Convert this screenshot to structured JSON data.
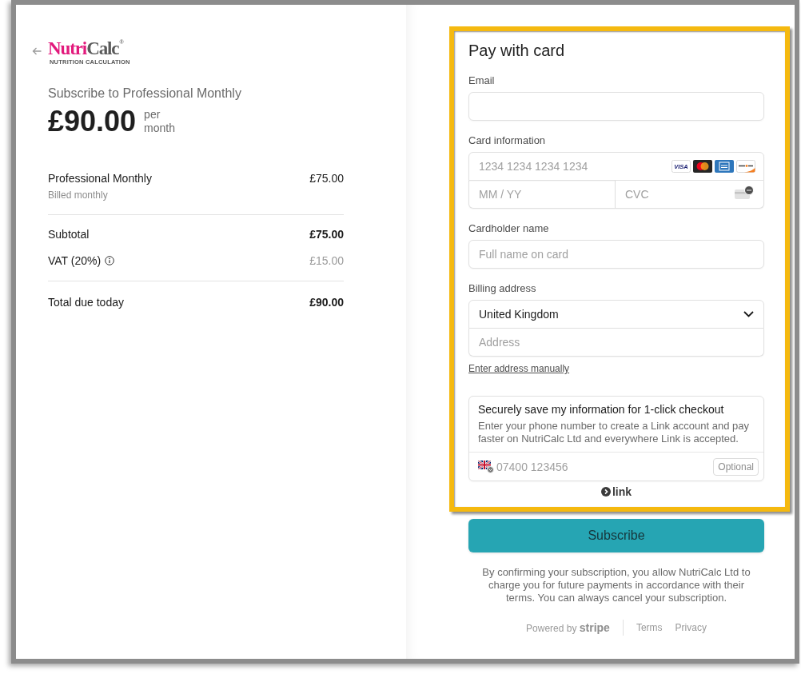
{
  "logo": {
    "name_parts": [
      "Nutri",
      "Calc"
    ],
    "registered_mark": "®",
    "tagline": "NUTRITION CALCULATION"
  },
  "summary": {
    "heading": "Subscribe to Professional Monthly",
    "price": "£90.00",
    "period": "per month"
  },
  "line_items": [
    {
      "name": "Professional Monthly",
      "note": "Billed monthly",
      "amount": "£75.00"
    }
  ],
  "totals": [
    {
      "kind": "subtotal",
      "label": "Subtotal",
      "amount": "£75.00"
    },
    {
      "kind": "tax",
      "label": "VAT (20%)",
      "amount": "£15.00"
    },
    {
      "kind": "total",
      "label": "Total due today",
      "amount": "£90.00"
    }
  ],
  "payment": {
    "highlighted": true,
    "title": "Pay with card",
    "email": {
      "label": "Email"
    },
    "card": {
      "label": "Card information",
      "number_placeholder": "1234 1234 1234 1234",
      "brands": [
        {
          "kind": "visa",
          "text": "VISA"
        },
        {
          "kind": "mastercard"
        },
        {
          "kind": "amex"
        },
        {
          "kind": "discover"
        }
      ],
      "expiry_placeholder": "MM / YY",
      "cvc_placeholder": "CVC"
    },
    "cardholder": {
      "label": "Cardholder name",
      "placeholder": "Full name on card"
    },
    "billing": {
      "label": "Billing address",
      "country": "United Kingdom",
      "address_placeholder": "Address",
      "manual_entry_link": "Enter address manually"
    },
    "link_signup": {
      "title": "Securely save my information for 1-click checkout",
      "description": "Enter your phone number to create a Link account and pay faster on NutriCalc Ltd and everywhere Link is accepted.",
      "phone_placeholder": "07400 123456",
      "optional_badge": "Optional"
    },
    "link_logo": "link"
  },
  "subscribe_button": "Subscribe",
  "legal_text": "By confirming your subscription, you allow NutriCalc Ltd to charge you for future payments in accordance with their terms. You can always cancel your subscription.",
  "footer": {
    "powered_by": "Powered by **stripe**",
    "links": [
      "Terms",
      "Privacy"
    ]
  }
}
